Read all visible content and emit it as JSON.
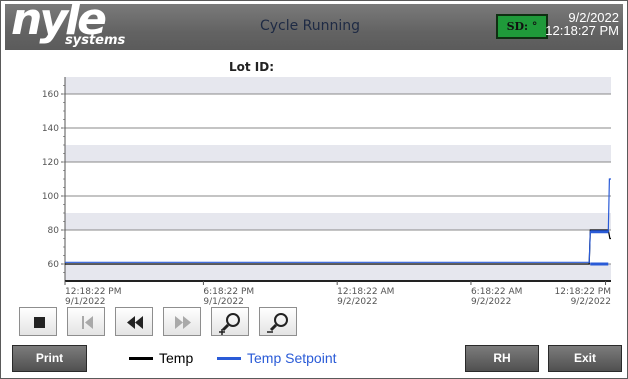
{
  "header": {
    "logo_main": "nyle",
    "logo_sub": "systems",
    "title": "Cycle Running",
    "sd_label": "SD: °",
    "date": "9/2/2022",
    "time": "12:18:27 PM"
  },
  "lot": {
    "label": "Lot ID:",
    "value": ""
  },
  "chart_data": {
    "type": "line",
    "yticks": [
      "160",
      "140",
      "120",
      "100",
      "80",
      "60"
    ],
    "ylim": [
      50,
      170
    ],
    "xticks": [
      {
        "time": "12:18:22 PM",
        "date": "9/1/2022"
      },
      {
        "time": "6:18:22 PM",
        "date": "9/1/2022"
      },
      {
        "time": "12:18:22 AM",
        "date": "9/2/2022"
      },
      {
        "time": "6:18:22 AM",
        "date": "9/2/2022"
      },
      {
        "time": "12:18:22 PM",
        "date": "9/2/2022"
      }
    ],
    "grid": true,
    "series": [
      {
        "name": "Temp",
        "color": "#000000",
        "x": [
          0,
          0.96,
          0.962,
          0.995,
          0.998,
          1.0
        ],
        "y": [
          60,
          60,
          80,
          80,
          75,
          75
        ]
      },
      {
        "name": "Temp Setpoint",
        "color": "#2a5bd7",
        "x": [
          0,
          0.96,
          0.962,
          0.995,
          0.997,
          1.0
        ],
        "y": [
          61,
          61,
          79,
          79,
          110,
          110
        ]
      }
    ]
  },
  "toolbar": {
    "buttons": [
      "stop-icon",
      "skip-start-icon",
      "rewind-icon",
      "fast-forward-icon",
      "zoom-in-icon",
      "zoom-out-icon"
    ]
  },
  "footer": {
    "print_label": "Print",
    "legend": [
      {
        "label": "Temp",
        "color": "#000000"
      },
      {
        "label": "Temp Setpoint",
        "color": "#2a5bd7"
      }
    ],
    "rh_label": "RH",
    "exit_label": "Exit"
  }
}
